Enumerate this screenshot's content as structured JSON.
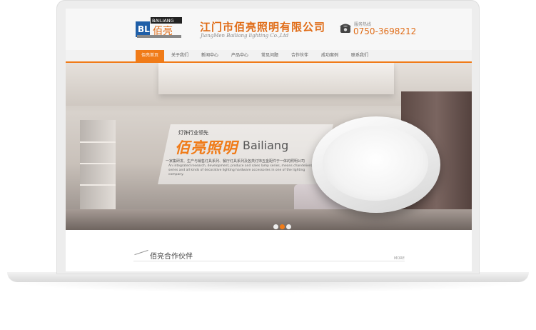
{
  "header": {
    "company_cn": "江门市佰亮照明有限公司",
    "company_en": "JiangMen Bailiang lighting Co.,Ltd",
    "logo_text": "BAILIANG",
    "logo_initials": "BL",
    "logo_cn": "佰亮",
    "hotline_label": "服务热线",
    "hotline_number": "0750-3698212"
  },
  "nav": {
    "items": [
      {
        "label": "佰亮首页"
      },
      {
        "label": "关于我们"
      },
      {
        "label": "新闻中心"
      },
      {
        "label": "产品中心"
      },
      {
        "label": "常见问题"
      },
      {
        "label": "合作伙伴"
      },
      {
        "label": "成功案例"
      },
      {
        "label": "联系我们"
      }
    ]
  },
  "banner": {
    "tagline": "灯饰行业领先",
    "brand_cn": "佰亮照明",
    "brand_en": "Bailiang",
    "desc_cn": "一家集研发、生产与销售灯具系列、餐厅灯具系列及各类灯饰五金配件于一体的照明公司",
    "desc_en": "An integrated research, development, produce and sales lamp series, means chandeliers series and all kinds of decorative lighting hardware accessories in one of the lighting company.",
    "slides": [
      "1",
      "2",
      "3"
    ]
  },
  "partners": {
    "title": "佰亮合作伙伴",
    "more": "MORE"
  },
  "colors": {
    "accent": "#f07b18",
    "logo_blue": "#1f5fa8"
  }
}
